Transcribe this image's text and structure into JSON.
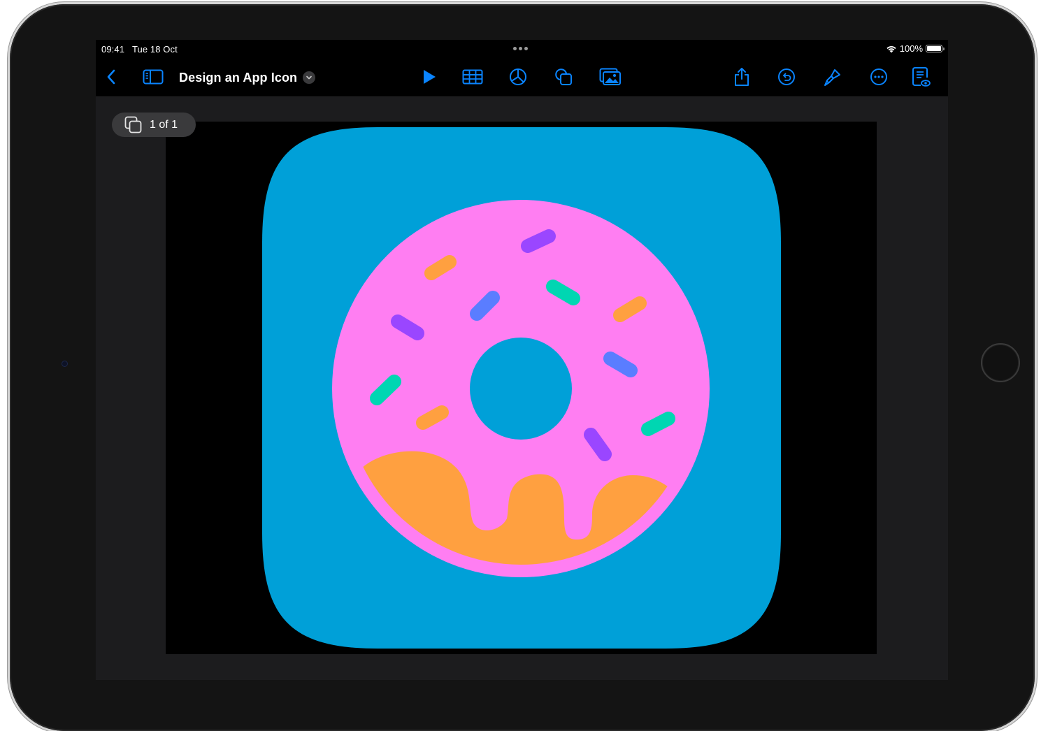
{
  "status_bar": {
    "time": "09:41",
    "date": "Tue 18 Oct",
    "battery": "100%"
  },
  "toolbar": {
    "back_icon": "chevron-left-icon",
    "sidebar_icon": "sidebar-icon",
    "title": "Design an App Icon",
    "title_menu_icon": "chevron-down-icon",
    "center_icons": [
      "play-icon",
      "table-icon",
      "chart-icon",
      "shape-icon",
      "media-icon"
    ],
    "right_icons": [
      "share-icon",
      "undo-icon",
      "paintbrush-icon",
      "more-icon",
      "reader-view-icon"
    ]
  },
  "page_indicator": {
    "label": "1 of 1",
    "icon": "slides-icon"
  },
  "colors": {
    "accent": "#0a84ff",
    "icon_background": "#00a0d8",
    "donut_pink": "#ff7ef2",
    "glaze_orange": "#ffa040",
    "sprinkle_purple": "#9a46ff",
    "sprinkle_blue": "#5a7dff",
    "sprinkle_teal": "#00d6b2",
    "sprinkle_orange": "#ffa040"
  }
}
